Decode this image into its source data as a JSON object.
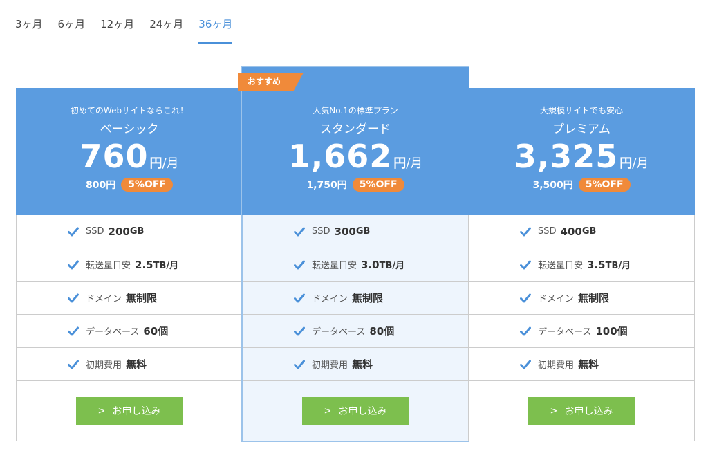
{
  "tabs": [
    "3ヶ月",
    "6ヶ月",
    "12ヶ月",
    "24ヶ月",
    "36ヶ月"
  ],
  "active_tab": "36ヶ月",
  "colors": {
    "header": "#5b9ce0",
    "accent": "#4a90d9",
    "off_badge": "#f08a3a",
    "cta": "#7dbf4e"
  },
  "plans": [
    {
      "subtitle": "初めてのWebサイトならこれ！",
      "name": "ベーシック",
      "price": "760",
      "yen": "円",
      "per": "/月",
      "old_price": "800円",
      "discount": "5%OFF",
      "features": [
        {
          "label": "SSD",
          "value": "200",
          "unit": "GB"
        },
        {
          "label": "転送量目安",
          "value": "2.5",
          "unit": "TB/月"
        },
        {
          "label": "ドメイン",
          "value": "無制限",
          "unit": ""
        },
        {
          "label": "データベース",
          "value": "60個",
          "unit": ""
        },
        {
          "label": "初期費用",
          "value": "無料",
          "unit": ""
        }
      ],
      "cta": "お申し込み"
    },
    {
      "badge": "おすすめ",
      "subtitle": "人気No.1の標準プラン",
      "name": "スタンダード",
      "price": "1,662",
      "yen": "円",
      "per": "/月",
      "old_price": "1,750円",
      "discount": "5%OFF",
      "features": [
        {
          "label": "SSD",
          "value": "300",
          "unit": "GB"
        },
        {
          "label": "転送量目安",
          "value": "3.0",
          "unit": "TB/月"
        },
        {
          "label": "ドメイン",
          "value": "無制限",
          "unit": ""
        },
        {
          "label": "データベース",
          "value": "80個",
          "unit": ""
        },
        {
          "label": "初期費用",
          "value": "無料",
          "unit": ""
        }
      ],
      "cta": "お申し込み"
    },
    {
      "subtitle": "大規模サイトでも安心",
      "name": "プレミアム",
      "price": "3,325",
      "yen": "円",
      "per": "/月",
      "old_price": "3,500円",
      "discount": "5%OFF",
      "features": [
        {
          "label": "SSD",
          "value": "400",
          "unit": "GB"
        },
        {
          "label": "転送量目安",
          "value": "3.5",
          "unit": "TB/月"
        },
        {
          "label": "ドメイン",
          "value": "無制限",
          "unit": ""
        },
        {
          "label": "データベース",
          "value": "100個",
          "unit": ""
        },
        {
          "label": "初期費用",
          "value": "無料",
          "unit": ""
        }
      ],
      "cta": "お申し込み"
    }
  ]
}
